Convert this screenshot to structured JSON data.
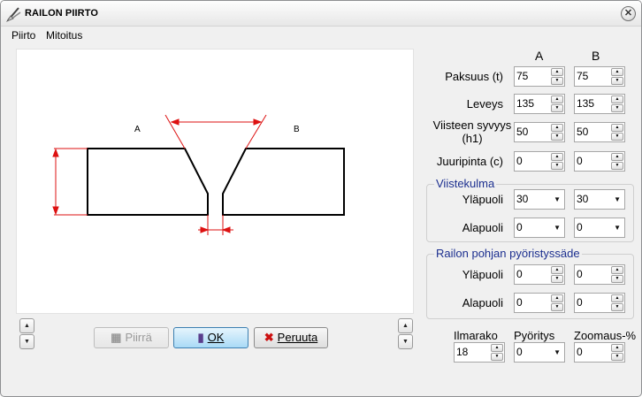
{
  "window": {
    "title": "RAILON PIIRTO",
    "close_glyph": "✕"
  },
  "menu": [
    "Piirto",
    "Mitoitus"
  ],
  "drawing": {
    "label_a": "A",
    "label_b": "B"
  },
  "buttons": {
    "draw": "Piirrä",
    "ok": "OK",
    "cancel": "Peruuta"
  },
  "icons": {
    "app": "draw-tool-icon",
    "draw": "draw-icon",
    "ok": "ok-icon",
    "cancel": "cancel-x-icon"
  },
  "columns": {
    "a": "A",
    "b": "B"
  },
  "params": [
    {
      "label": "Paksuus (t)",
      "a": "75",
      "b": "75"
    },
    {
      "label": "Leveys",
      "a": "135",
      "b": "135"
    },
    {
      "label": "Viisteen syvyys (h1)",
      "a": "50",
      "b": "50"
    },
    {
      "label": "Juuripinta (c)",
      "a": "0",
      "b": "0"
    }
  ],
  "bevel_angle": {
    "title": "Viistekulma",
    "upper": {
      "label": "Yläpuoli",
      "a": "30",
      "b": "30"
    },
    "lower": {
      "label": "Alapuoli",
      "a": "0",
      "b": "0"
    }
  },
  "root_radius": {
    "title": "Railon pohjan pyöristyssäde",
    "upper": {
      "label": "Yläpuoli",
      "a": "0",
      "b": "0"
    },
    "lower": {
      "label": "Alapuoli",
      "a": "0",
      "b": "0"
    }
  },
  "bottom": {
    "gap": {
      "label": "Ilmarako",
      "value": "18"
    },
    "rounding": {
      "label": "Pyöritys",
      "value": "0"
    },
    "zoom": {
      "label": "Zoomaus-%",
      "value": "0"
    }
  },
  "colors": {
    "dimension": "#dd1111",
    "group_title": "#1c2f8f",
    "ok_button": "#a9daf6"
  }
}
